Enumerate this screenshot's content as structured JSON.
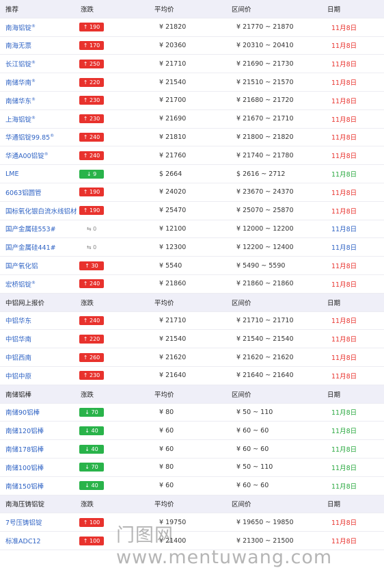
{
  "sections": [
    {
      "header": {
        "name": "推荐",
        "change": "涨跌",
        "avg": "平均价",
        "range": "区间价",
        "date": "日期"
      },
      "rows": [
        {
          "name": "南海铝锭",
          "tag": "®",
          "change": "↑ 190",
          "dir": "up",
          "avg": "¥ 21820",
          "range": "¥ 21770 ~ 21870",
          "date": "11月8日",
          "date_color": "red"
        },
        {
          "name": "南海无票",
          "tag": "",
          "change": "↑ 170",
          "dir": "up",
          "avg": "¥ 20360",
          "range": "¥ 20310 ~ 20410",
          "date": "11月8日",
          "date_color": "red"
        },
        {
          "name": "长江铝锭",
          "tag": "®",
          "change": "↑ 250",
          "dir": "up",
          "avg": "¥ 21710",
          "range": "¥ 21690 ~ 21730",
          "date": "11月8日",
          "date_color": "red"
        },
        {
          "name": "南储华南",
          "tag": "®",
          "change": "↑ 220",
          "dir": "up",
          "avg": "¥ 21540",
          "range": "¥ 21510 ~ 21570",
          "date": "11月8日",
          "date_color": "red"
        },
        {
          "name": "南储华东",
          "tag": "®",
          "change": "↑ 230",
          "dir": "up",
          "avg": "¥ 21700",
          "range": "¥ 21680 ~ 21720",
          "date": "11月8日",
          "date_color": "red"
        },
        {
          "name": "上海铝锭",
          "tag": "®",
          "change": "↑ 230",
          "dir": "up",
          "avg": "¥ 21690",
          "range": "¥ 21670 ~ 21710",
          "date": "11月8日",
          "date_color": "red"
        },
        {
          "name": "华通铝锭99.85",
          "tag": "®",
          "change": "↑ 240",
          "dir": "up",
          "avg": "¥ 21810",
          "range": "¥ 21800 ~ 21820",
          "date": "11月8日",
          "date_color": "red"
        },
        {
          "name": "华通A00铝锭",
          "tag": "®",
          "change": "↑ 240",
          "dir": "up",
          "avg": "¥ 21760",
          "range": "¥ 21740 ~ 21780",
          "date": "11月8日",
          "date_color": "red"
        },
        {
          "name": "LME",
          "tag": "",
          "change": "↓ 9",
          "dir": "down",
          "avg": "$ 2664",
          "range": "$ 2616 ~ 2712",
          "date": "11月8日",
          "date_color": "green"
        },
        {
          "name": "6063铝圆管",
          "tag": "",
          "change": "↑ 190",
          "dir": "up",
          "avg": "¥ 24020",
          "range": "¥ 23670 ~ 24370",
          "date": "11月8日",
          "date_color": "red"
        },
        {
          "name": "国标氧化银白流水线铝材",
          "tag": "",
          "change": "↑ 190",
          "dir": "up",
          "avg": "¥ 25470",
          "range": "¥ 25070 ~ 25870",
          "date": "11月8日",
          "date_color": "red"
        },
        {
          "name": "国产金属硅553#",
          "tag": "",
          "change": "⇆ 0",
          "dir": "flat",
          "avg": "¥ 12100",
          "range": "¥ 12000 ~ 12200",
          "date": "11月8日",
          "date_color": "blue"
        },
        {
          "name": "国产金属硅441#",
          "tag": "",
          "change": "⇆ 0",
          "dir": "flat",
          "avg": "¥ 12300",
          "range": "¥ 12200 ~ 12400",
          "date": "11月8日",
          "date_color": "blue"
        },
        {
          "name": "国产氧化铝",
          "tag": "",
          "change": "↑ 30",
          "dir": "up",
          "avg": "¥ 5540",
          "range": "¥ 5490 ~ 5590",
          "date": "11月8日",
          "date_color": "red"
        },
        {
          "name": "宏桥铝锭",
          "tag": "®",
          "change": "↑ 240",
          "dir": "up",
          "avg": "¥ 21860",
          "range": "¥ 21860 ~ 21860",
          "date": "11月8日",
          "date_color": "red"
        }
      ]
    },
    {
      "header": {
        "name": "中铝网上报价",
        "change": "涨跌",
        "avg": "平均价",
        "range": "区间价",
        "date": "日期"
      },
      "rows": [
        {
          "name": "中铝华东",
          "tag": "",
          "change": "↑ 240",
          "dir": "up",
          "avg": "¥ 21710",
          "range": "¥ 21710 ~ 21710",
          "date": "11月8日",
          "date_color": "red"
        },
        {
          "name": "中铝华南",
          "tag": "",
          "change": "↑ 220",
          "dir": "up",
          "avg": "¥ 21540",
          "range": "¥ 21540 ~ 21540",
          "date": "11月8日",
          "date_color": "red"
        },
        {
          "name": "中铝西南",
          "tag": "",
          "change": "↑ 260",
          "dir": "up",
          "avg": "¥ 21620",
          "range": "¥ 21620 ~ 21620",
          "date": "11月8日",
          "date_color": "red"
        },
        {
          "name": "中铝中原",
          "tag": "",
          "change": "↑ 230",
          "dir": "up",
          "avg": "¥ 21640",
          "range": "¥ 21640 ~ 21640",
          "date": "11月8日",
          "date_color": "red"
        }
      ]
    },
    {
      "header": {
        "name": "南储铝棒",
        "change": "涨跌",
        "avg": "平均价",
        "range": "区间价",
        "date": "日期"
      },
      "rows": [
        {
          "name": "南储90铝棒",
          "tag": "",
          "change": "↓ 70",
          "dir": "down",
          "avg": "¥ 80",
          "range": "¥ 50 ~ 110",
          "date": "11月8日",
          "date_color": "green"
        },
        {
          "name": "南储120铝棒",
          "tag": "",
          "change": "↓ 40",
          "dir": "down",
          "avg": "¥ 60",
          "range": "¥ 60 ~ 60",
          "date": "11月8日",
          "date_color": "green"
        },
        {
          "name": "南储178铝棒",
          "tag": "",
          "change": "↓ 40",
          "dir": "down",
          "avg": "¥ 60",
          "range": "¥ 60 ~ 60",
          "date": "11月8日",
          "date_color": "green"
        },
        {
          "name": "南储100铝棒",
          "tag": "",
          "change": "↓ 70",
          "dir": "down",
          "avg": "¥ 80",
          "range": "¥ 50 ~ 110",
          "date": "11月8日",
          "date_color": "green"
        },
        {
          "name": "南储150铝棒",
          "tag": "",
          "change": "↓ 40",
          "dir": "down",
          "avg": "¥ 60",
          "range": "¥ 60 ~ 60",
          "date": "11月8日",
          "date_color": "green"
        }
      ]
    },
    {
      "header": {
        "name": "南海压铸铝锭",
        "change": "涨跌",
        "avg": "平均价",
        "range": "区间价",
        "date": "日期"
      },
      "rows": [
        {
          "name": "7号压铸铝锭",
          "tag": "",
          "change": "↑ 100",
          "dir": "up",
          "avg": "¥ 19750",
          "range": "¥ 19650 ~ 19850",
          "date": "11月8日",
          "date_color": "red"
        },
        {
          "name": "标准ADC12",
          "tag": "",
          "change": "↑ 100",
          "dir": "up",
          "avg": "¥ 21400",
          "range": "¥ 21300 ~ 21500",
          "date": "11月8日",
          "date_color": "red"
        }
      ]
    }
  ],
  "watermark": "门图网 www.mentuwang.com"
}
